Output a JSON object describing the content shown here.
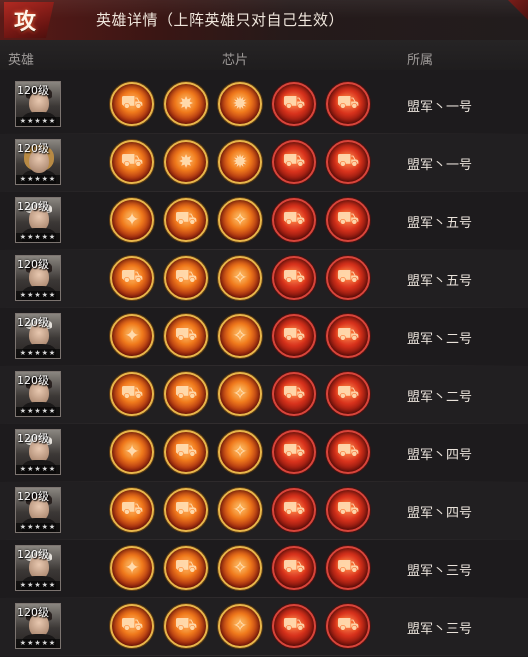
{
  "header": {
    "badge": "攻",
    "title": "英雄详情（上阵英雄只对自己生效）"
  },
  "columns": {
    "hero": "英雄",
    "chips": "芯片",
    "affiliation": "所属"
  },
  "rows": [
    {
      "level": "120级",
      "stars": "★★★★★",
      "portrait": "soldier-sunglasses",
      "affiliation": "盟军丶一号",
      "chips": [
        {
          "icon": "tank-chip-icon",
          "theme": "orange"
        },
        {
          "icon": "fire-burst-chip-icon",
          "theme": "orange"
        },
        {
          "icon": "explosion-chip-icon",
          "theme": "orange"
        },
        {
          "icon": "tank-fire-chip-icon",
          "theme": "red"
        },
        {
          "icon": "tank-red-chip-icon",
          "theme": "red"
        }
      ]
    },
    {
      "level": "120级",
      "stars": "★★★★★",
      "portrait": "female-blonde",
      "affiliation": "盟军丶一号",
      "chips": [
        {
          "icon": "tank-chip-icon",
          "theme": "orange"
        },
        {
          "icon": "fire-burst-chip-icon",
          "theme": "orange"
        },
        {
          "icon": "explosion-chip-icon",
          "theme": "orange"
        },
        {
          "icon": "tank-fire-chip-icon",
          "theme": "red"
        },
        {
          "icon": "tank-red-chip-icon",
          "theme": "red"
        }
      ]
    },
    {
      "level": "120级",
      "stars": "★★★★★",
      "portrait": "officer-cap",
      "affiliation": "盟军丶五号",
      "chips": [
        {
          "icon": "blast-chip-icon",
          "theme": "orange"
        },
        {
          "icon": "tank-chip-icon",
          "theme": "orange"
        },
        {
          "icon": "flare-chip-icon",
          "theme": "orange"
        },
        {
          "icon": "tank-fire-chip-icon",
          "theme": "red"
        },
        {
          "icon": "tank-red-chip-icon",
          "theme": "red"
        }
      ]
    },
    {
      "level": "120级",
      "stars": "★★★★★",
      "portrait": "soldier-beard",
      "affiliation": "盟军丶五号",
      "chips": [
        {
          "icon": "tank-chip-icon",
          "theme": "orange"
        },
        {
          "icon": "tank-chip-icon",
          "theme": "orange"
        },
        {
          "icon": "flare-chip-icon",
          "theme": "orange"
        },
        {
          "icon": "tank-fire-chip-icon",
          "theme": "red"
        },
        {
          "icon": "tank-red-chip-icon",
          "theme": "red"
        }
      ]
    },
    {
      "level": "120级",
      "stars": "★★★★★",
      "portrait": "officer-cap",
      "affiliation": "盟军丶二号",
      "chips": [
        {
          "icon": "blast-chip-icon",
          "theme": "orange"
        },
        {
          "icon": "tank-chip-icon",
          "theme": "orange"
        },
        {
          "icon": "flare-chip-icon",
          "theme": "orange"
        },
        {
          "icon": "tank-fire-chip-icon",
          "theme": "red"
        },
        {
          "icon": "tank-red-chip-icon",
          "theme": "red"
        }
      ]
    },
    {
      "level": "120级",
      "stars": "★★★★★",
      "portrait": "soldier-beard",
      "affiliation": "盟军丶二号",
      "chips": [
        {
          "icon": "tank-chip-icon",
          "theme": "orange"
        },
        {
          "icon": "tank-chip-icon",
          "theme": "orange"
        },
        {
          "icon": "flare-chip-icon",
          "theme": "orange"
        },
        {
          "icon": "tank-fire-chip-icon",
          "theme": "red"
        },
        {
          "icon": "tank-red-chip-icon",
          "theme": "red"
        }
      ]
    },
    {
      "level": "120级",
      "stars": "★★★★★",
      "portrait": "officer-cap",
      "affiliation": "盟军丶四号",
      "chips": [
        {
          "icon": "blast-chip-icon",
          "theme": "orange"
        },
        {
          "icon": "tank-chip-icon",
          "theme": "orange"
        },
        {
          "icon": "flare-chip-icon",
          "theme": "orange"
        },
        {
          "icon": "tank-fire-chip-icon",
          "theme": "red"
        },
        {
          "icon": "tank-red-chip-icon",
          "theme": "red"
        }
      ]
    },
    {
      "level": "120级",
      "stars": "★★★★★",
      "portrait": "soldier-beard",
      "affiliation": "盟军丶四号",
      "chips": [
        {
          "icon": "tank-chip-icon",
          "theme": "orange"
        },
        {
          "icon": "tank-chip-icon",
          "theme": "orange"
        },
        {
          "icon": "flare-chip-icon",
          "theme": "orange"
        },
        {
          "icon": "tank-fire-chip-icon",
          "theme": "red"
        },
        {
          "icon": "tank-red-chip-icon",
          "theme": "red"
        }
      ]
    },
    {
      "level": "120级",
      "stars": "★★★★★",
      "portrait": "officer-cap",
      "affiliation": "盟军丶三号",
      "chips": [
        {
          "icon": "blast-chip-icon",
          "theme": "orange"
        },
        {
          "icon": "tank-chip-icon",
          "theme": "orange"
        },
        {
          "icon": "flare-chip-icon",
          "theme": "orange"
        },
        {
          "icon": "tank-fire-chip-icon",
          "theme": "red"
        },
        {
          "icon": "tank-red-chip-icon",
          "theme": "red"
        }
      ]
    },
    {
      "level": "120级",
      "stars": "★★★★★",
      "portrait": "soldier-beard",
      "affiliation": "盟军丶三号",
      "chips": [
        {
          "icon": "tank-chip-icon",
          "theme": "orange"
        },
        {
          "icon": "tank-chip-icon",
          "theme": "orange"
        },
        {
          "icon": "flare-chip-icon",
          "theme": "orange"
        },
        {
          "icon": "tank-fire-chip-icon",
          "theme": "red"
        },
        {
          "icon": "tank-red-chip-icon",
          "theme": "red"
        }
      ]
    }
  ]
}
